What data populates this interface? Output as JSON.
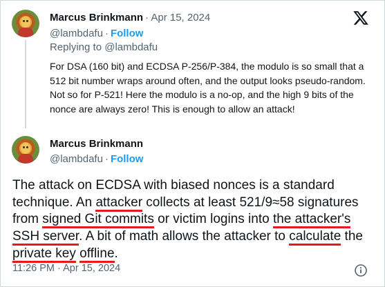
{
  "reply_tweet": {
    "author_name": "Marcus Brinkmann",
    "separator": "·",
    "date": "Apr 15, 2024",
    "handle": "@lambdafu",
    "follow_label": "Follow",
    "replying_to": "Replying to @lambdafu",
    "text": "For DSA (160 bit) and ECDSA P-256/P-384, the modulo is so small that a 512 bit number wraps around often, and the output looks pseudo-random. Not so for P-521! Here the modulo is a no-op, and the high 9 bits of the nonce are always zero! This is enough to allow an attack!"
  },
  "main_tweet": {
    "author_name": "Marcus Brinkmann",
    "handle": "@lambdafu",
    "follow_label": "Follow",
    "text_segments": [
      {
        "text": "The attack on ECDSA with biased nonces is a standard technique. An ",
        "underlined": false
      },
      {
        "text": "attacker",
        "underlined": true
      },
      {
        "text": " collects at least 521/9≈58 signatures from ",
        "underlined": false
      },
      {
        "text": "signed Git commits",
        "underlined": true
      },
      {
        "text": " or victim logins into ",
        "underlined": false
      },
      {
        "text": "the attacker's SSH server",
        "underlined": true
      },
      {
        "text": ". A bit of math allows the attacker to ",
        "underlined": false
      },
      {
        "text": "calculate",
        "underlined": true
      },
      {
        "text": " the ",
        "underlined": false
      },
      {
        "text": "private key",
        "underlined": true
      },
      {
        "text": " ",
        "underlined": false
      },
      {
        "text": "offline",
        "underlined": true
      },
      {
        "text": ".",
        "underlined": false
      }
    ],
    "time": "11:26 PM",
    "separator": "·",
    "date": "Apr 15, 2024"
  },
  "icons": {
    "brand": "x-logo-icon",
    "info": "info-icon"
  },
  "colors": {
    "link": "#1d9bf0",
    "secondary_text": "#536471",
    "underline_annotation": "#e8191d"
  }
}
